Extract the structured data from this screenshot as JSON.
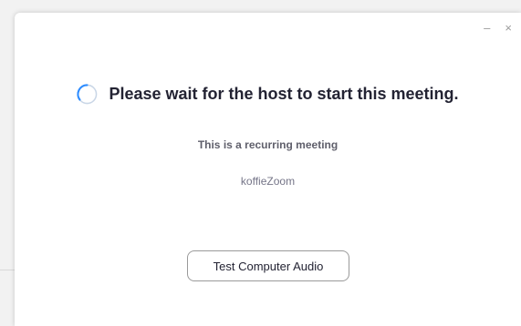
{
  "window": {
    "controls": {
      "minimize": "–",
      "close": "×"
    }
  },
  "main": {
    "wait_message": "Please wait for the host to start this meeting.",
    "recurring_text": "This is a recurring meeting",
    "meeting_name": "koffieZoom",
    "test_audio_label": "Test Computer Audio"
  },
  "colors": {
    "spinner_accent": "#2d8cff",
    "spinner_track": "#c9d6e6",
    "title_text": "#232333"
  },
  "icons": {
    "spinner": "loading-spinner-icon"
  }
}
